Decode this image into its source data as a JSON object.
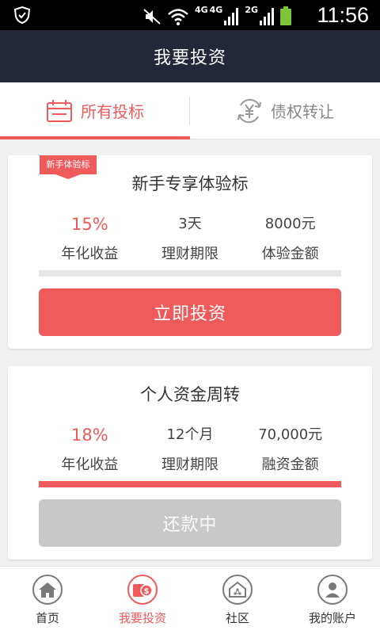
{
  "status_bar": {
    "network_1": "4G",
    "network_2": "4G",
    "network_3": "2G",
    "time": "11:56"
  },
  "header": {
    "title": "我要投资"
  },
  "tabs": [
    {
      "label": "所有投标",
      "icon": "calendar-icon",
      "active": true
    },
    {
      "label": "债权转让",
      "icon": "yen-transfer-icon",
      "active": false
    }
  ],
  "cards": [
    {
      "badge": "新手体验标",
      "title": "新手专享体验标",
      "rate": "15%",
      "rate_label": "年化收益",
      "term": "3天",
      "term_label": "理财期限",
      "amount": "8000元",
      "amount_label": "体验金额",
      "progress": 0,
      "button_label": "立即投资"
    },
    {
      "title": "个人资金周转",
      "rate": "18%",
      "rate_label": "年化收益",
      "term": "12个月",
      "term_label": "理财期限",
      "amount": "70,000元",
      "amount_label": "融资金额",
      "progress": 100,
      "button_label": "还款中"
    }
  ],
  "bottom_nav": [
    {
      "label": "首页",
      "icon": "home-icon",
      "active": false
    },
    {
      "label": "我要投资",
      "icon": "invest-icon",
      "active": true
    },
    {
      "label": "社区",
      "icon": "community-icon",
      "active": false
    },
    {
      "label": "我的账户",
      "icon": "user-icon",
      "active": false
    }
  ],
  "colors": {
    "accent": "#ef5a5a",
    "header_bg": "#232838",
    "disabled_button": "#c8c8c8",
    "battery": "#7cc53b"
  }
}
